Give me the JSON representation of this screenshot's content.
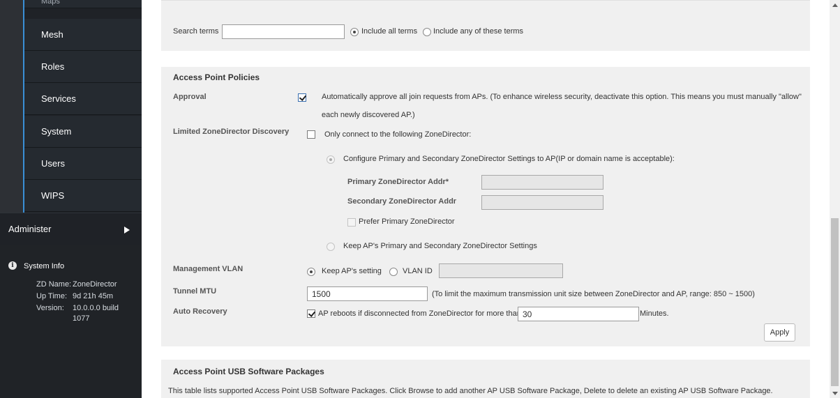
{
  "sidebar": {
    "items": [
      {
        "label": "Maps"
      },
      {
        "label": "Mesh"
      },
      {
        "label": "Roles"
      },
      {
        "label": "Services"
      },
      {
        "label": "System"
      },
      {
        "label": "Users"
      },
      {
        "label": "WIPS"
      }
    ],
    "administer": "Administer",
    "system_info": {
      "title": "System Info",
      "zd_name_key": "ZD Name:",
      "zd_name_val": "ZoneDirector",
      "uptime_key": "Up Time:",
      "uptime_val": "9d 21h 45m",
      "version_key": "Version:",
      "version_val_1": "10.0.0.0 build",
      "version_val_2": "1077"
    }
  },
  "search": {
    "label": "Search terms",
    "value": "",
    "include_all": "Include all terms",
    "include_any": "Include any of these terms"
  },
  "policies": {
    "title": "Access Point Policies",
    "approval": {
      "label": "Approval",
      "text_1": "Automatically approve all join requests from APs.   (To enhance wireless security, deactivate this option. This means you must manually \"allow\"",
      "text_2": "each newly discovered AP.)"
    },
    "discovery": {
      "label": "Limited ZoneDirector Discovery",
      "only_connect": "Only connect to the following ZoneDirector:",
      "configure": "Configure Primary and Secondary ZoneDirector Settings to AP(IP or domain name is acceptable):",
      "primary_label": "Primary ZoneDirector Addr*",
      "secondary_label": "Secondary ZoneDirector Addr",
      "prefer_primary": "Prefer Primary ZoneDirector",
      "keep_settings": "Keep AP's Primary and Secondary ZoneDirector Settings"
    },
    "vlan": {
      "label": "Management VLAN",
      "keep": "Keep AP's setting",
      "vlan_id": "VLAN ID"
    },
    "mtu": {
      "label": "Tunnel MTU",
      "value": "1500",
      "hint": "(To limit the maximum transmission unit size between ZoneDirector and AP, range: 850 ~ 1500)"
    },
    "recovery": {
      "label": "Auto Recovery",
      "text": "AP reboots if disconnected from ZoneDirector for more than",
      "value": "30",
      "unit": "Minutes."
    },
    "apply": "Apply"
  },
  "usb": {
    "title": "Access Point USB Software Packages",
    "description": "This table lists supported Access Point USB Software Packages. Click Browse to add another AP USB Software Package, Delete to delete an existing AP USB Software Package."
  }
}
